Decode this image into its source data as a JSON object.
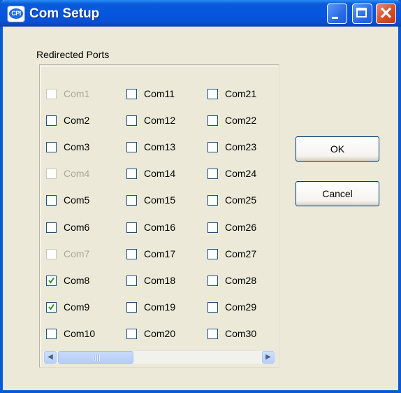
{
  "window": {
    "title": "Com Setup",
    "app_icon_text": "CPI"
  },
  "group": {
    "label": "Redirected Ports"
  },
  "ports": [
    {
      "label": "Com1",
      "checked": false,
      "disabled": true
    },
    {
      "label": "Com2",
      "checked": false,
      "disabled": false
    },
    {
      "label": "Com3",
      "checked": false,
      "disabled": false
    },
    {
      "label": "Com4",
      "checked": false,
      "disabled": true
    },
    {
      "label": "Com5",
      "checked": false,
      "disabled": false
    },
    {
      "label": "Com6",
      "checked": false,
      "disabled": false
    },
    {
      "label": "Com7",
      "checked": false,
      "disabled": true
    },
    {
      "label": "Com8",
      "checked": true,
      "disabled": false
    },
    {
      "label": "Com9",
      "checked": true,
      "disabled": false
    },
    {
      "label": "Com10",
      "checked": false,
      "disabled": false
    },
    {
      "label": "Com11",
      "checked": false,
      "disabled": false
    },
    {
      "label": "Com12",
      "checked": false,
      "disabled": false
    },
    {
      "label": "Com13",
      "checked": false,
      "disabled": false
    },
    {
      "label": "Com14",
      "checked": false,
      "disabled": false
    },
    {
      "label": "Com15",
      "checked": false,
      "disabled": false
    },
    {
      "label": "Com16",
      "checked": false,
      "disabled": false
    },
    {
      "label": "Com17",
      "checked": false,
      "disabled": false
    },
    {
      "label": "Com18",
      "checked": false,
      "disabled": false
    },
    {
      "label": "Com19",
      "checked": false,
      "disabled": false
    },
    {
      "label": "Com20",
      "checked": false,
      "disabled": false
    },
    {
      "label": "Com21",
      "checked": false,
      "disabled": false
    },
    {
      "label": "Com22",
      "checked": false,
      "disabled": false
    },
    {
      "label": "Com23",
      "checked": false,
      "disabled": false
    },
    {
      "label": "Com24",
      "checked": false,
      "disabled": false
    },
    {
      "label": "Com25",
      "checked": false,
      "disabled": false
    },
    {
      "label": "Com26",
      "checked": false,
      "disabled": false
    },
    {
      "label": "Com27",
      "checked": false,
      "disabled": false
    },
    {
      "label": "Com28",
      "checked": false,
      "disabled": false
    },
    {
      "label": "Com29",
      "checked": false,
      "disabled": false
    },
    {
      "label": "Com30",
      "checked": false,
      "disabled": false
    }
  ],
  "buttons": {
    "ok_label": "OK",
    "cancel_label": "Cancel"
  },
  "colors": {
    "titlebar": "#0a5ad8",
    "dialog_bg": "#ece9d8",
    "checkmark": "#21a121",
    "disabled_text": "#aca899"
  },
  "icons": {
    "app": "cpi-app-icon",
    "minimize": "minimize-icon",
    "maximize": "maximize-icon",
    "close": "close-icon",
    "scroll_left": "arrow-left-icon",
    "scroll_right": "arrow-right-icon"
  }
}
